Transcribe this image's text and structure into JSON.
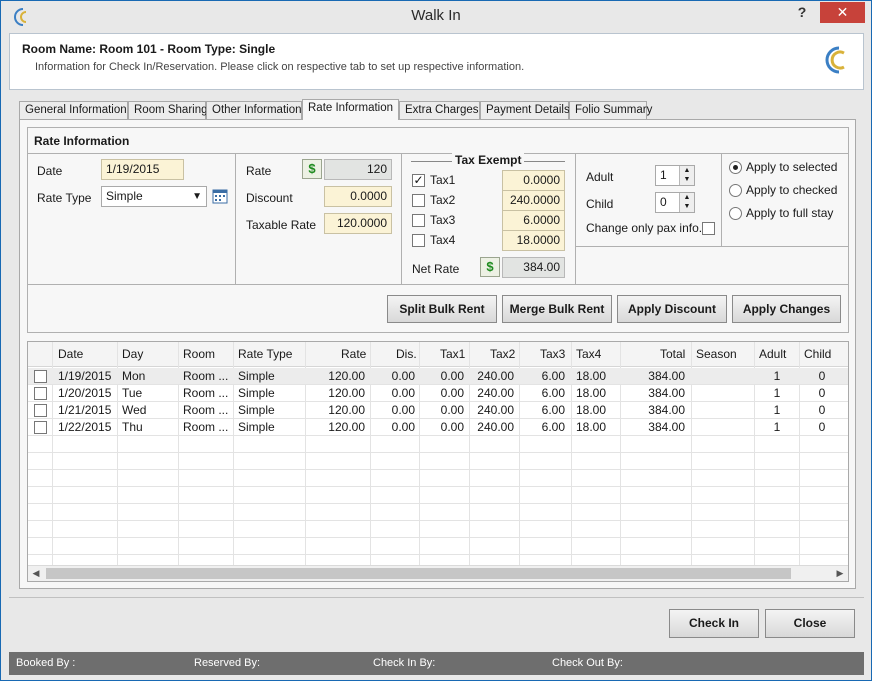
{
  "window": {
    "title": "Walk In",
    "help": "?",
    "close": "✕"
  },
  "header": {
    "room_name": "Room Name: Room 101 - Room Type: Single",
    "info": "Information for Check In/Reservation. Please click on respective tab to set up respective information."
  },
  "tabs": [
    {
      "label": "General Information"
    },
    {
      "label": "Room Sharing"
    },
    {
      "label": "Other Information"
    },
    {
      "label": "Rate Information"
    },
    {
      "label": "Extra Charges"
    },
    {
      "label": "Payment Details"
    },
    {
      "label": "Folio Summary"
    }
  ],
  "active_tab": "Rate Information",
  "rate_info": {
    "section_title": "Rate Information",
    "date_label": "Date",
    "date_value": "1/19/2015",
    "rate_type_label": "Rate Type",
    "rate_type_value": "Simple",
    "rate_label": "Rate",
    "rate_value": "120",
    "discount_label": "Discount",
    "discount_value": "0.0000",
    "taxable_rate_label": "Taxable Rate",
    "taxable_rate_value": "120.0000",
    "tax_exempt_title": "Tax Exempt",
    "taxes": [
      {
        "label": "Tax1",
        "value": "0.0000",
        "checked": true
      },
      {
        "label": "Tax2",
        "value": "240.0000",
        "checked": false
      },
      {
        "label": "Tax3",
        "value": "6.0000",
        "checked": false
      },
      {
        "label": "Tax4",
        "value": "18.0000",
        "checked": false
      }
    ],
    "net_rate_label": "Net Rate",
    "net_rate_value": "384.00",
    "adult_label": "Adult",
    "adult_value": "1",
    "child_label": "Child",
    "child_value": "0",
    "change_pax_label": "Change only pax info.",
    "apply_options": [
      {
        "label": "Apply to selected",
        "selected": true
      },
      {
        "label": "Apply to checked",
        "selected": false
      },
      {
        "label": "Apply to full stay",
        "selected": false
      }
    ]
  },
  "actions": {
    "split": "Split Bulk Rent",
    "merge": "Merge Bulk Rent",
    "discount": "Apply Discount",
    "changes": "Apply Changes"
  },
  "grid": {
    "columns": [
      "Date",
      "Day",
      "Room",
      "Rate Type",
      "Rate",
      "Dis.",
      "Tax1",
      "Tax2",
      "Tax3",
      "Tax4",
      "Total",
      "Season",
      "Adult",
      "Child"
    ],
    "rows": [
      [
        "1/19/2015",
        "Mon",
        "Room ...",
        "Simple",
        "120.00",
        "0.00",
        "0.00",
        "240.00",
        "6.00",
        "18.00",
        "384.00",
        "",
        "1",
        "0"
      ],
      [
        "1/20/2015",
        "Tue",
        "Room ...",
        "Simple",
        "120.00",
        "0.00",
        "0.00",
        "240.00",
        "6.00",
        "18.00",
        "384.00",
        "",
        "1",
        "0"
      ],
      [
        "1/21/2015",
        "Wed",
        "Room ...",
        "Simple",
        "120.00",
        "0.00",
        "0.00",
        "240.00",
        "6.00",
        "18.00",
        "384.00",
        "",
        "1",
        "0"
      ],
      [
        "1/22/2015",
        "Thu",
        "Room ...",
        "Simple",
        "120.00",
        "0.00",
        "0.00",
        "240.00",
        "6.00",
        "18.00",
        "384.00",
        "",
        "1",
        "0"
      ]
    ]
  },
  "footer": {
    "check_in": "Check In",
    "close": "Close"
  },
  "status": {
    "booked_by": "Booked By :",
    "reserved_by": "Reserved By:",
    "check_in_by": "Check In By:",
    "check_out_by": "Check Out By:"
  },
  "colors": {
    "field_bg": "#fbf3d6",
    "status_bar": "#6e6e6e",
    "close_button": "#c7423a"
  },
  "icons": [
    "app-logo-icon",
    "calendar-icon",
    "dollar-icon",
    "close-icon",
    "help-icon"
  ]
}
